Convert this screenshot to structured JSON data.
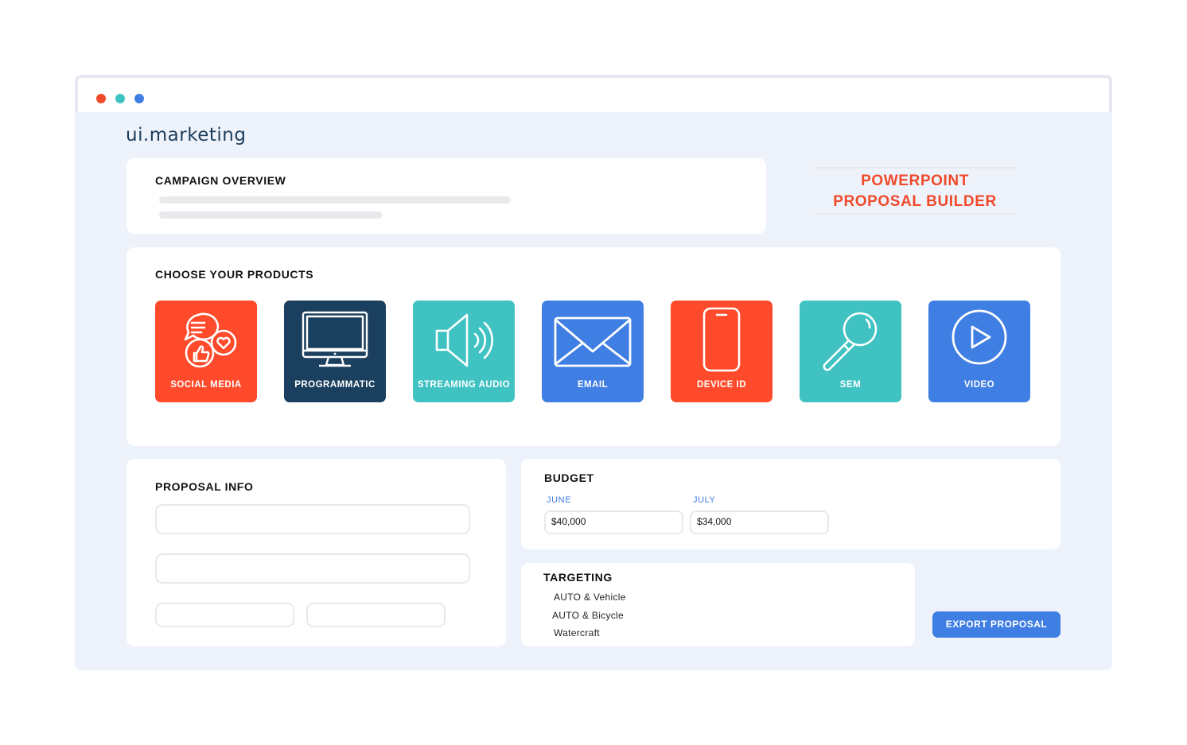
{
  "app": {
    "logo_text": "ui.marketing",
    "window_dots": [
      "#f04a2a",
      "#3dc3c3",
      "#3f7ee3"
    ]
  },
  "overview": {
    "title": "CAMPAIGN OVERVIEW"
  },
  "builder": {
    "line1": "POWERPOINT",
    "line2": "PROPOSAL BUILDER"
  },
  "products": {
    "title": "CHOOSE YOUR PRODUCTS",
    "items": [
      {
        "label": "SOCIAL MEDIA",
        "icon": "social-media-icon",
        "color": "#ff4b2b"
      },
      {
        "label": "PROGRAMMATIC",
        "icon": "monitor-icon",
        "color": "#1b3f5e"
      },
      {
        "label": "STREAMING AUDIO",
        "icon": "speaker-icon",
        "color": "#40c2c2"
      },
      {
        "label": "EMAIL",
        "icon": "envelope-icon",
        "color": "#3f7ee3"
      },
      {
        "label": "DEVICE ID",
        "icon": "smartphone-icon",
        "color": "#ff4b2b"
      },
      {
        "label": "SEM",
        "icon": "magnifier-icon",
        "color": "#40c2c2"
      },
      {
        "label": "VIDEO",
        "icon": "play-icon",
        "color": "#3f7ee3"
      }
    ]
  },
  "proposal": {
    "title": "PROPOSAL INFO"
  },
  "budget": {
    "title": "BUDGET",
    "months": [
      {
        "label": "JUNE",
        "value": "$40,000"
      },
      {
        "label": "JULY",
        "value": "$34,000"
      }
    ]
  },
  "targeting": {
    "title": "TARGETING",
    "items": [
      "AUTO & Vehicle",
      "AUTO & Bicycle",
      "Watercraft"
    ]
  },
  "export": {
    "label": "EXPORT PROPOSAL"
  }
}
